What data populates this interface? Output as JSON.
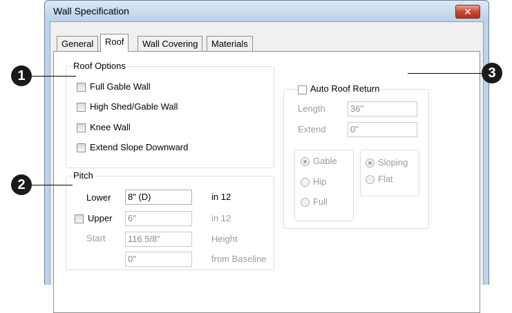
{
  "window": {
    "title": "Wall Specification",
    "close_label": "✕"
  },
  "tabs": [
    "General",
    "Roof",
    "Wall Covering",
    "Materials"
  ],
  "roof_options": {
    "title": "Roof Options",
    "items": [
      "Full Gable Wall",
      "High Shed/Gable Wall",
      "Knee Wall",
      "Extend Slope Downward"
    ]
  },
  "pitch": {
    "title": "Pitch",
    "lower_label": "Lower",
    "lower_value": "8\" (D)",
    "lower_unit": "in 12",
    "upper_label": "Upper",
    "upper_value": "6\"",
    "upper_unit": "in 12",
    "start_label": "Start",
    "start_value": "116 5/8\"",
    "start_unit": "Height",
    "baseline_value": "0\"",
    "baseline_unit": "from Baseline"
  },
  "auto_roof": {
    "title": "Auto Roof Return",
    "length_label": "Length",
    "length_value": "36\"",
    "extend_label": "Extend",
    "extend_value": "0\"",
    "type_options": [
      "Gable",
      "Hip",
      "Full"
    ],
    "slope_options": [
      "Sloping",
      "Flat"
    ]
  },
  "callouts": [
    "1",
    "2",
    "3"
  ]
}
